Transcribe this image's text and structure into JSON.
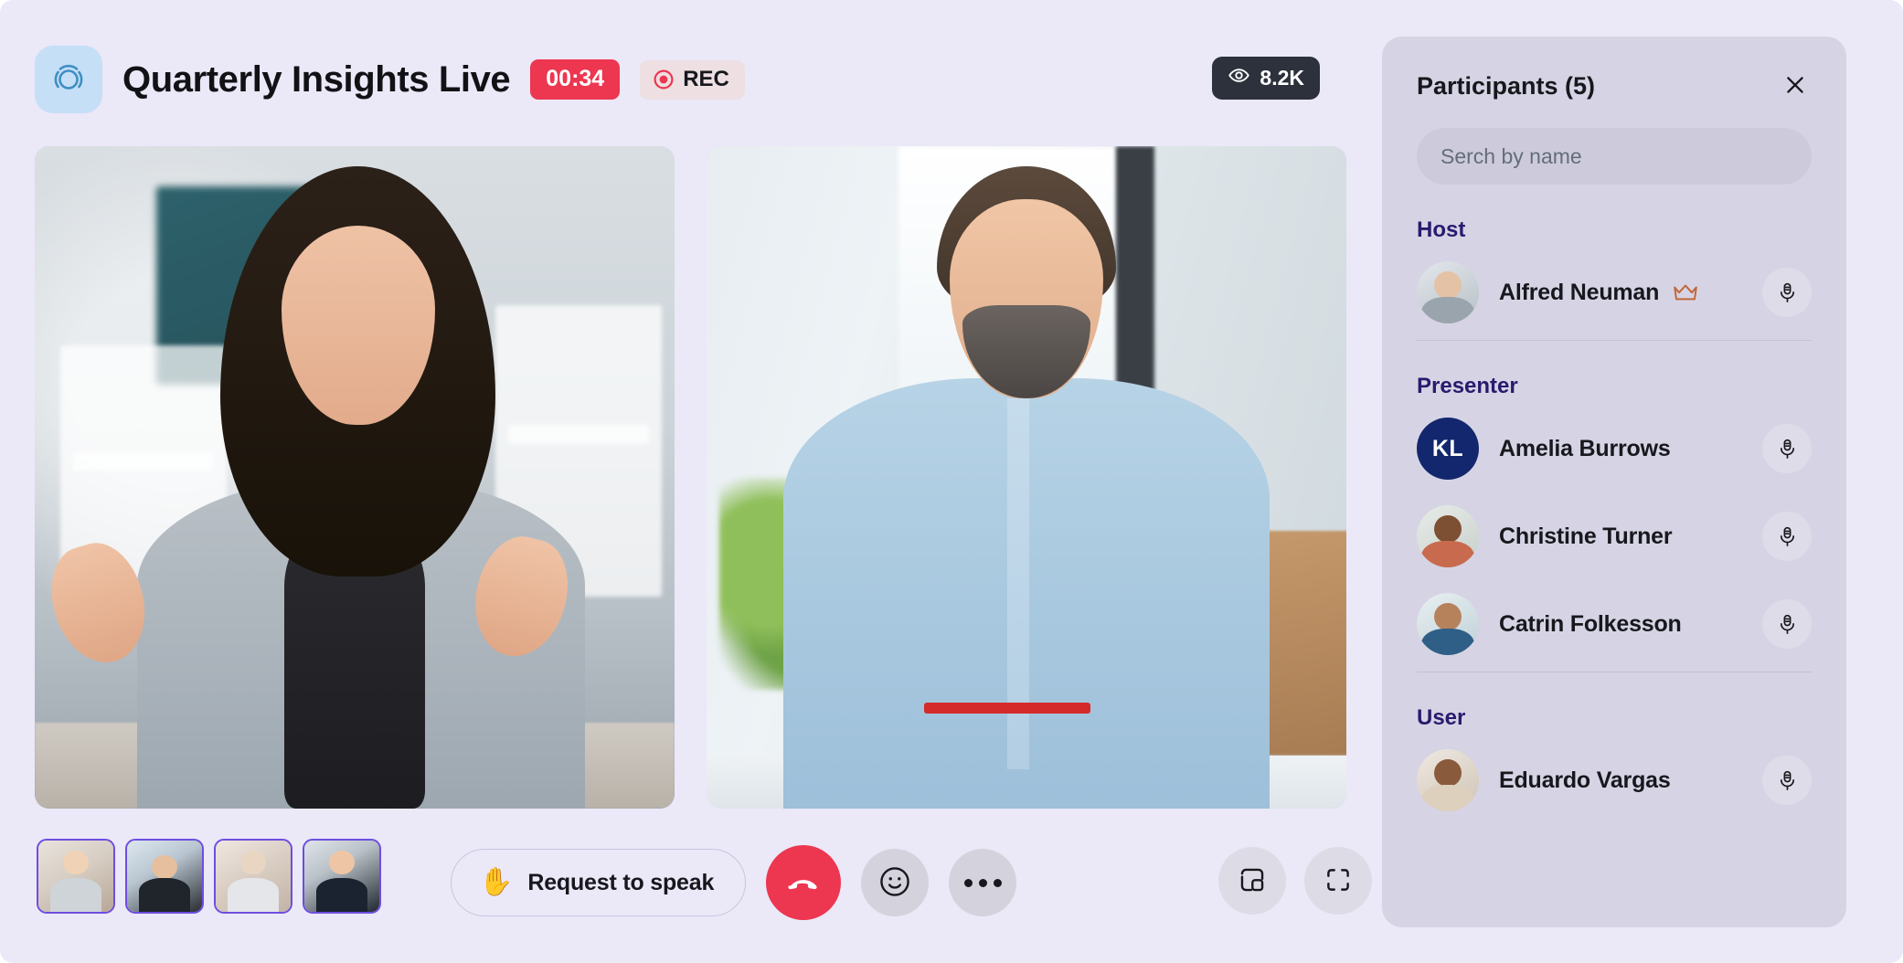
{
  "header": {
    "logo_icon": "broadcast-circle-icon",
    "title": "Quarterly Insights Live",
    "timer": "00:34",
    "rec_label": "REC",
    "rec_icon": "record-dot-icon",
    "viewers": {
      "icon": "eye-icon",
      "count": "8.2K"
    }
  },
  "stage": {
    "tiles": [
      {
        "name": "main-video-tile-1",
        "subject": "woman in gray blazer gesturing at desk"
      },
      {
        "name": "main-video-tile-2",
        "subject": "bearded man in light blue shirt holding red pen"
      }
    ],
    "thumbnails": [
      {
        "name": "thumbnail-1",
        "subject": "blonde woman in library"
      },
      {
        "name": "thumbnail-2",
        "subject": "man with headset writing"
      },
      {
        "name": "thumbnail-3",
        "subject": "older woman in striped top"
      },
      {
        "name": "thumbnail-4",
        "subject": "man in dark suit and tie"
      }
    ]
  },
  "controls": {
    "request_to_speak": {
      "label": "Request to speak",
      "icon": "raised-hand-icon"
    },
    "end_call_icon": "end-call-handset-icon",
    "reaction_icon": "smiley-face-icon",
    "more_icon": "more-ellipsis-icon",
    "pip_icon": "picture-in-picture-icon",
    "fullscreen_icon": "fullscreen-expand-icon"
  },
  "panel": {
    "title": "Participants (5)",
    "close_icon": "close-x-icon",
    "search": {
      "placeholder": "Serch by name",
      "value": ""
    },
    "groups": [
      {
        "label": "Host",
        "members": [
          {
            "name": "Alfred Neuman",
            "avatar_type": "photo",
            "avatar_class": "av1",
            "badge_icon": "crown-icon",
            "mic_icon": "microphone-icon"
          }
        ]
      },
      {
        "label": "Presenter",
        "members": [
          {
            "name": "Amelia Burrows",
            "avatar_type": "initials",
            "initials": "KL",
            "mic_icon": "microphone-icon"
          },
          {
            "name": "Christine Turner",
            "avatar_type": "photo",
            "avatar_class": "av2",
            "mic_icon": "microphone-icon"
          },
          {
            "name": "Catrin Folkesson",
            "avatar_type": "photo",
            "avatar_class": "av3",
            "mic_icon": "microphone-icon"
          }
        ]
      },
      {
        "label": "User",
        "members": [
          {
            "name": "Eduardo Vargas",
            "avatar_type": "photo",
            "avatar_class": "av4",
            "mic_icon": "microphone-icon"
          }
        ]
      }
    ]
  },
  "colors": {
    "page_bg": "#ebe8f8",
    "panel_bg": "#d6d4e4",
    "accent_red": "#ed3650",
    "accent_indigo": "#281b6e",
    "thumb_border": "#6d4ee0",
    "avatar_navy": "#13276e",
    "crown_orange": "#c2673a",
    "viewer_badge_bg": "#2c313c"
  }
}
